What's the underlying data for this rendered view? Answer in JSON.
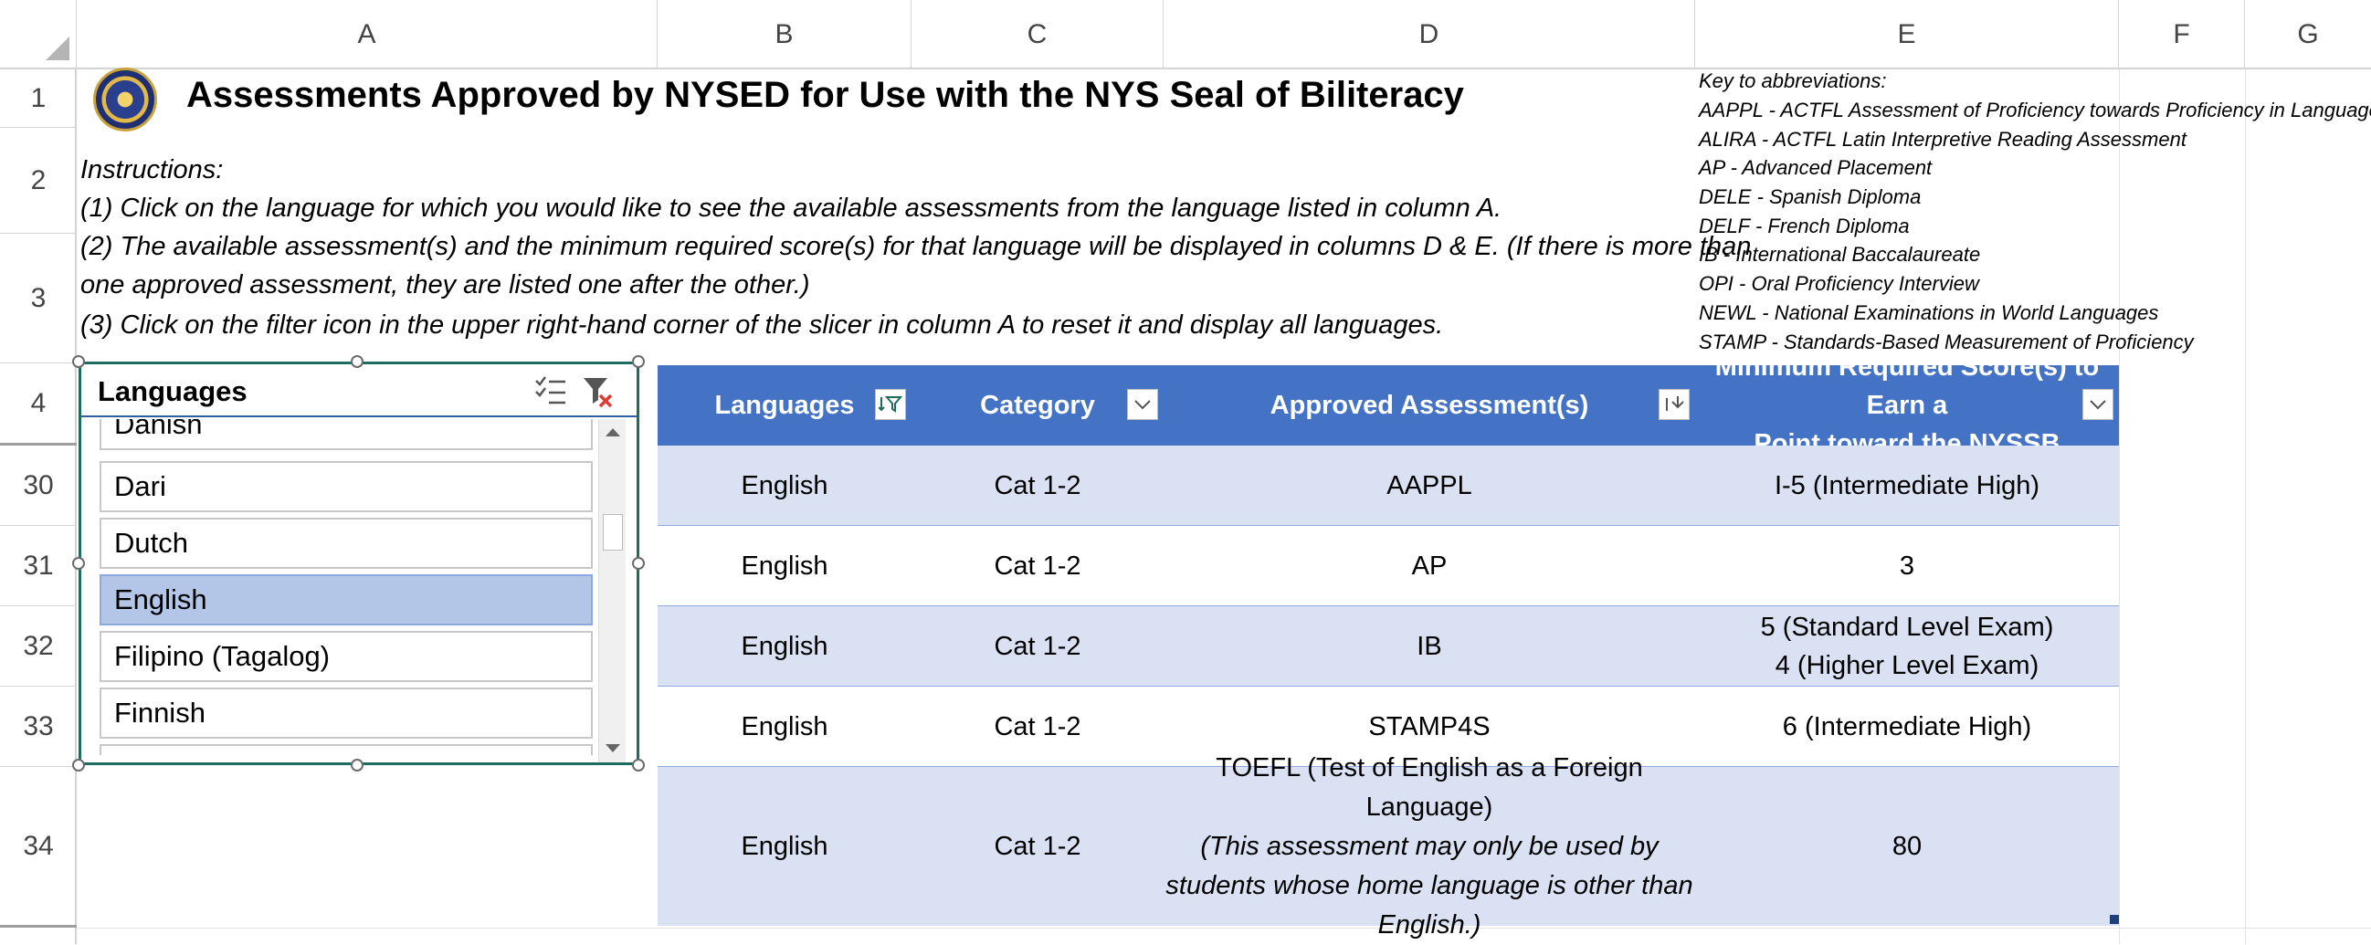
{
  "columns": [
    "A",
    "B",
    "C",
    "D",
    "E",
    "F",
    "G"
  ],
  "rows": [
    "1",
    "2",
    "3",
    "4",
    "30",
    "31",
    "32",
    "33",
    "34"
  ],
  "title": "Assessments Approved by NYSED for Use with the NYS Seal of Biliteracy",
  "instructions": {
    "heading": "Instructions:",
    "step1": "(1) Click on the language for which you would like to see the available assessments from the language listed in column A.",
    "step2a": "(2) The available assessment(s) and the minimum required score(s) for that language will be displayed in columns D & E.  (If there is more than",
    "step2b": "one approved assessment, they are listed one after the other.)",
    "step3": "(3) Click on the filter icon in the upper right-hand corner of the slicer in column A to reset it and display all languages."
  },
  "abbreviations": {
    "title": "Key to abbreviations:",
    "items": [
      "AAPPL - ACTFL Assessment of Proficiency towards Proficiency in Language",
      "ALIRA - ACTFL Latin Interpretive Reading Assessment",
      "AP - Advanced Placement",
      "DELE - Spanish Diploma",
      "DELF - French Diploma",
      "IB - International Baccalaureate",
      "OPI - Oral Proficiency Interview",
      "NEWL - National Examinations in World Languages",
      "STAMP - Standards-Based Measurement of Proficiency"
    ]
  },
  "slicer": {
    "title": "Languages",
    "partial_item": "Danish",
    "items": [
      "Dari",
      "Dutch",
      "English",
      "Filipino (Tagalog)",
      "Finnish"
    ],
    "selected": "English"
  },
  "table": {
    "headers": [
      "Languages",
      "Category",
      "Approved Assessment(s)",
      "Minimum Required Score(s) to Earn a",
      "Point toward the NYSSB"
    ],
    "rows": [
      {
        "lang": "English",
        "cat": "Cat 1-2",
        "assess": "AAPPL",
        "score": "I-5 (Intermediate High)"
      },
      {
        "lang": "English",
        "cat": "Cat 1-2",
        "assess": "AP",
        "score": "3"
      },
      {
        "lang": "English",
        "cat": "Cat 1-2",
        "assess": "IB",
        "score": "5 (Standard Level Exam)",
        "score2": "4 (Higher Level Exam)"
      },
      {
        "lang": "English",
        "cat": "Cat 1-2",
        "assess": "STAMP4S",
        "score": "6 (Intermediate High)"
      },
      {
        "lang": "English",
        "cat": "Cat 1-2",
        "assess": "TOEFL (Test of English as a Foreign Language)",
        "assess_note1": "(This assessment may only be used by",
        "assess_note2": "students whose home language is other than",
        "assess_note3": "English.)",
        "score": "80"
      }
    ]
  },
  "colors": {
    "header_blue": "#4472c4",
    "band_light": "#d9e1f2",
    "slicer_selected": "#b4c6e7",
    "slicer_border": "#1e6b5f"
  }
}
